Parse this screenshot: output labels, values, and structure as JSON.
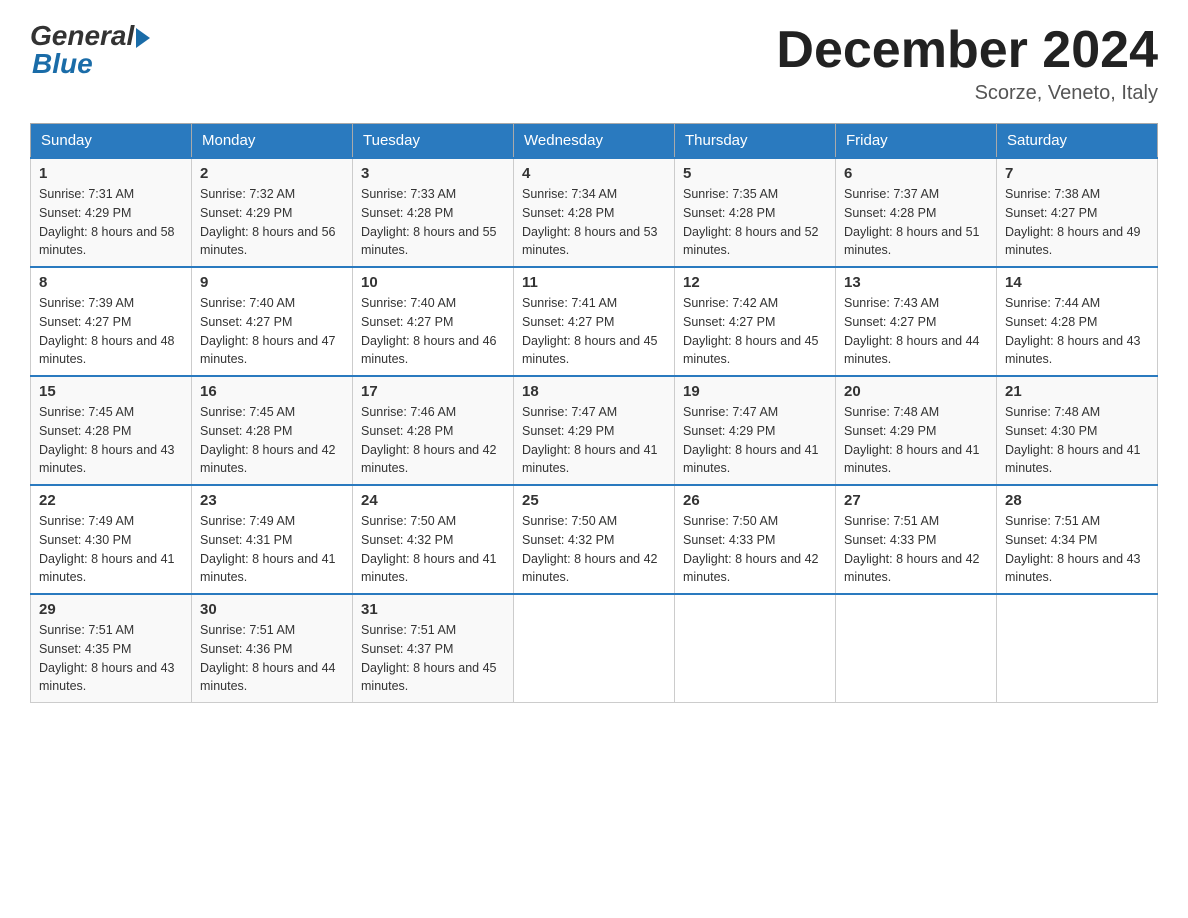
{
  "logo": {
    "general_text": "General",
    "blue_text": "Blue"
  },
  "header": {
    "month": "December 2024",
    "location": "Scorze, Veneto, Italy"
  },
  "weekdays": [
    "Sunday",
    "Monday",
    "Tuesday",
    "Wednesday",
    "Thursday",
    "Friday",
    "Saturday"
  ],
  "weeks": [
    [
      {
        "day": "1",
        "sunrise": "7:31 AM",
        "sunset": "4:29 PM",
        "daylight": "8 hours and 58 minutes."
      },
      {
        "day": "2",
        "sunrise": "7:32 AM",
        "sunset": "4:29 PM",
        "daylight": "8 hours and 56 minutes."
      },
      {
        "day": "3",
        "sunrise": "7:33 AM",
        "sunset": "4:28 PM",
        "daylight": "8 hours and 55 minutes."
      },
      {
        "day": "4",
        "sunrise": "7:34 AM",
        "sunset": "4:28 PM",
        "daylight": "8 hours and 53 minutes."
      },
      {
        "day": "5",
        "sunrise": "7:35 AM",
        "sunset": "4:28 PM",
        "daylight": "8 hours and 52 minutes."
      },
      {
        "day": "6",
        "sunrise": "7:37 AM",
        "sunset": "4:28 PM",
        "daylight": "8 hours and 51 minutes."
      },
      {
        "day": "7",
        "sunrise": "7:38 AM",
        "sunset": "4:27 PM",
        "daylight": "8 hours and 49 minutes."
      }
    ],
    [
      {
        "day": "8",
        "sunrise": "7:39 AM",
        "sunset": "4:27 PM",
        "daylight": "8 hours and 48 minutes."
      },
      {
        "day": "9",
        "sunrise": "7:40 AM",
        "sunset": "4:27 PM",
        "daylight": "8 hours and 47 minutes."
      },
      {
        "day": "10",
        "sunrise": "7:40 AM",
        "sunset": "4:27 PM",
        "daylight": "8 hours and 46 minutes."
      },
      {
        "day": "11",
        "sunrise": "7:41 AM",
        "sunset": "4:27 PM",
        "daylight": "8 hours and 45 minutes."
      },
      {
        "day": "12",
        "sunrise": "7:42 AM",
        "sunset": "4:27 PM",
        "daylight": "8 hours and 45 minutes."
      },
      {
        "day": "13",
        "sunrise": "7:43 AM",
        "sunset": "4:27 PM",
        "daylight": "8 hours and 44 minutes."
      },
      {
        "day": "14",
        "sunrise": "7:44 AM",
        "sunset": "4:28 PM",
        "daylight": "8 hours and 43 minutes."
      }
    ],
    [
      {
        "day": "15",
        "sunrise": "7:45 AM",
        "sunset": "4:28 PM",
        "daylight": "8 hours and 43 minutes."
      },
      {
        "day": "16",
        "sunrise": "7:45 AM",
        "sunset": "4:28 PM",
        "daylight": "8 hours and 42 minutes."
      },
      {
        "day": "17",
        "sunrise": "7:46 AM",
        "sunset": "4:28 PM",
        "daylight": "8 hours and 42 minutes."
      },
      {
        "day": "18",
        "sunrise": "7:47 AM",
        "sunset": "4:29 PM",
        "daylight": "8 hours and 41 minutes."
      },
      {
        "day": "19",
        "sunrise": "7:47 AM",
        "sunset": "4:29 PM",
        "daylight": "8 hours and 41 minutes."
      },
      {
        "day": "20",
        "sunrise": "7:48 AM",
        "sunset": "4:29 PM",
        "daylight": "8 hours and 41 minutes."
      },
      {
        "day": "21",
        "sunrise": "7:48 AM",
        "sunset": "4:30 PM",
        "daylight": "8 hours and 41 minutes."
      }
    ],
    [
      {
        "day": "22",
        "sunrise": "7:49 AM",
        "sunset": "4:30 PM",
        "daylight": "8 hours and 41 minutes."
      },
      {
        "day": "23",
        "sunrise": "7:49 AM",
        "sunset": "4:31 PM",
        "daylight": "8 hours and 41 minutes."
      },
      {
        "day": "24",
        "sunrise": "7:50 AM",
        "sunset": "4:32 PM",
        "daylight": "8 hours and 41 minutes."
      },
      {
        "day": "25",
        "sunrise": "7:50 AM",
        "sunset": "4:32 PM",
        "daylight": "8 hours and 42 minutes."
      },
      {
        "day": "26",
        "sunrise": "7:50 AM",
        "sunset": "4:33 PM",
        "daylight": "8 hours and 42 minutes."
      },
      {
        "day": "27",
        "sunrise": "7:51 AM",
        "sunset": "4:33 PM",
        "daylight": "8 hours and 42 minutes."
      },
      {
        "day": "28",
        "sunrise": "7:51 AM",
        "sunset": "4:34 PM",
        "daylight": "8 hours and 43 minutes."
      }
    ],
    [
      {
        "day": "29",
        "sunrise": "7:51 AM",
        "sunset": "4:35 PM",
        "daylight": "8 hours and 43 minutes."
      },
      {
        "day": "30",
        "sunrise": "7:51 AM",
        "sunset": "4:36 PM",
        "daylight": "8 hours and 44 minutes."
      },
      {
        "day": "31",
        "sunrise": "7:51 AM",
        "sunset": "4:37 PM",
        "daylight": "8 hours and 45 minutes."
      },
      null,
      null,
      null,
      null
    ]
  ]
}
